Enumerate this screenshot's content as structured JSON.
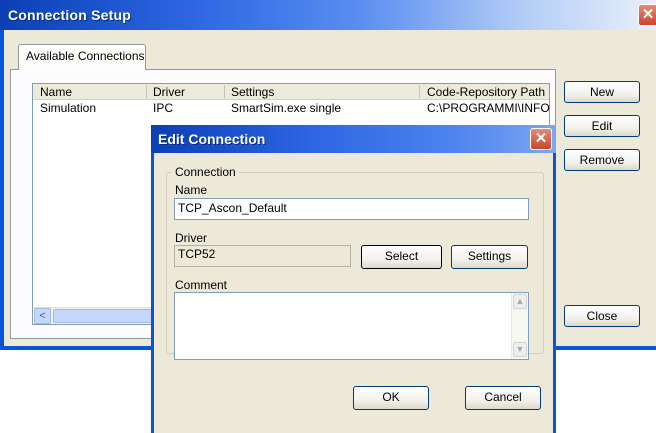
{
  "main_window": {
    "title": "Connection Setup",
    "close_glyph": "✕",
    "tab_label": "Available Connections",
    "columns": [
      "Name",
      "Driver",
      "Settings",
      "Code-Repository Path"
    ],
    "rows": [
      [
        "Simulation",
        "IPC",
        "SmartSim.exe single",
        "C:\\PROGRAMMI\\INFO"
      ]
    ],
    "buttons": {
      "new": "New",
      "edit": "Edit",
      "remove": "Remove",
      "close": "Close"
    },
    "scroll_left_glyph": "<"
  },
  "dialog": {
    "title": "Edit Connection",
    "close_glyph": "✕",
    "group_label": "Connection",
    "name_label": "Name",
    "name_value": "TCP_Ascon_Default",
    "driver_label": "Driver",
    "driver_value": "TCP52",
    "select_button": "Select",
    "settings_button": "Settings",
    "comment_label": "Comment",
    "comment_value": "",
    "ok_button": "OK",
    "cancel_button": "Cancel",
    "scroll_up_glyph": "▲",
    "scroll_down_glyph": "▼"
  },
  "colors": {
    "xp_blue": "#0a54d8",
    "window_face": "#ece9d8",
    "close_red": "#c9452c"
  }
}
